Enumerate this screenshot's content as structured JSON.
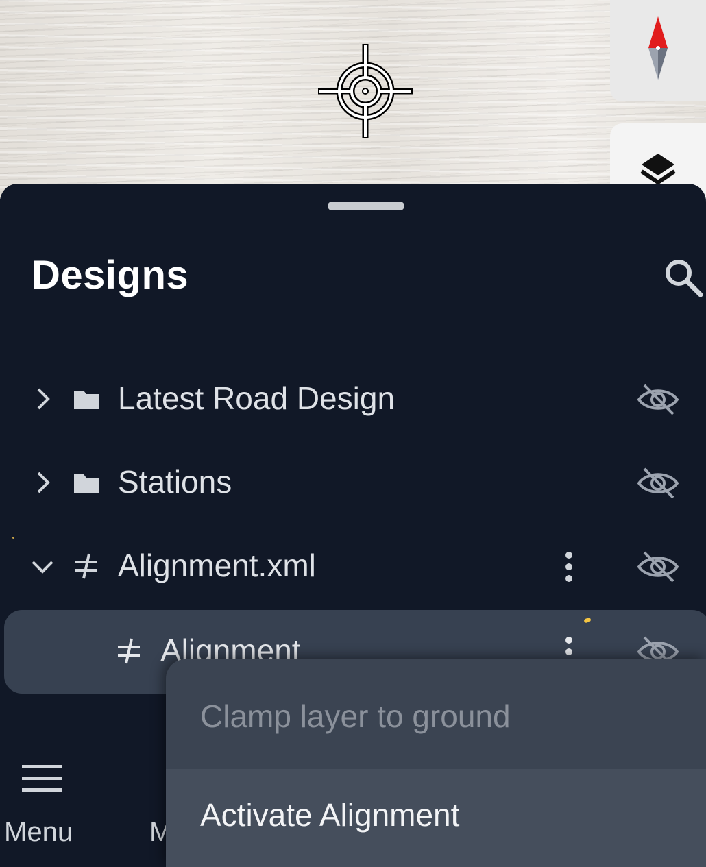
{
  "panel": {
    "title": "Designs"
  },
  "tree": {
    "items": [
      {
        "label": "Latest Road Design",
        "icon": "folder-icon",
        "expanded": false
      },
      {
        "label": "Stations",
        "icon": "folder-icon",
        "expanded": false
      },
      {
        "label": "Alignment.xml",
        "icon": "alignment-icon",
        "expanded": true
      },
      {
        "label": "Alignment",
        "icon": "alignment-icon",
        "selected": true
      }
    ]
  },
  "context_menu": {
    "items": [
      {
        "label": "Clamp layer to ground",
        "enabled": false
      },
      {
        "label": "Activate Alignment",
        "enabled": true
      }
    ]
  },
  "bottom_nav": {
    "menu_label": "Menu",
    "second_label_visible": "M"
  },
  "colors": {
    "panel_bg": "#111827",
    "selected_row_bg": "#374151",
    "menu_bg": "#3b4452",
    "compass_north": "#e11d1d"
  }
}
